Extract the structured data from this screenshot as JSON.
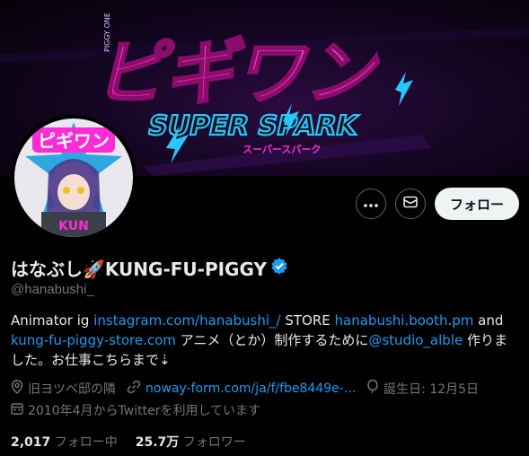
{
  "banner": {
    "small_caption": "PIGGY ONE",
    "title": "ピギワン",
    "subtitle": "SUPER SPARK",
    "subtitle_kana": "スーパースパーク",
    "colors": {
      "magenta": "#ff2bd6",
      "cyan": "#29c7ff",
      "purple": "#8a2be2"
    }
  },
  "avatar": {
    "logo_text": "ピギワン",
    "tag_text": "KUN"
  },
  "actions": {
    "follow_label": "フォロー"
  },
  "profile": {
    "display_name": "はなぶし🚀KUNG-FU-PIGGY",
    "verified": true,
    "handle": "@hanabushi_"
  },
  "bio": {
    "t1": "Animator ig ",
    "link1": "instagram.com/hanabushi_/",
    "t2": " STORE ",
    "link2": "hanabushi.booth.pm",
    "t3": " and ",
    "link3": "kung-fu-piggy-store.com",
    "t4": " アニメ（とか）制作するために",
    "link4": "@studio_alble",
    "t5": " 作りました。お仕事こちらまで⇣"
  },
  "meta": {
    "location": "旧ヨツベ邸の隣",
    "website": "noway-form.com/ja/f/fbe8449e-...",
    "birthday": "誕生日: 12月5日",
    "joined": "2010年4月からTwitterを利用しています"
  },
  "stats": {
    "following_count": "2,017",
    "following_label": "フォロー中",
    "followers_count": "25.7万",
    "followers_label": "フォロワー"
  }
}
